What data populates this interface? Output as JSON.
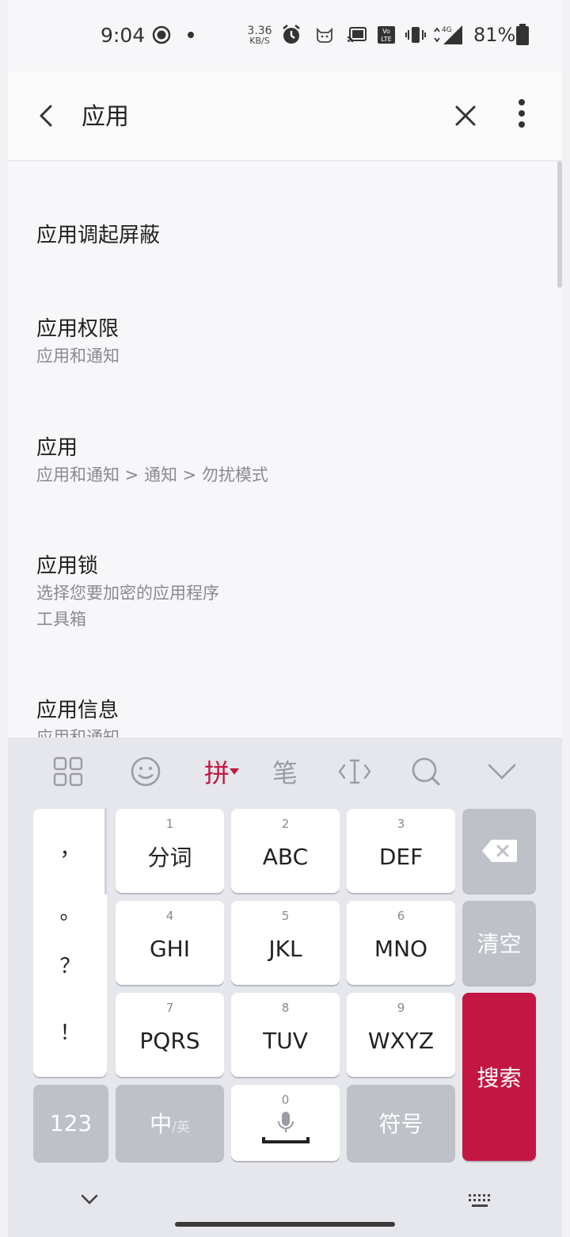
{
  "status_bar": {
    "time": "9:04",
    "net_speed_value": "3.36",
    "net_speed_unit": "KB/S",
    "battery": "81%",
    "icons": [
      "record-icon",
      "dot-icon",
      "alarm-icon",
      "cat-icon",
      "cast-icon",
      "volte-icon",
      "vibrate-icon",
      "4g-signal-icon",
      "battery-icon"
    ]
  },
  "topbar": {
    "title": "应用"
  },
  "results": [
    {
      "title": "应用调起屏蔽",
      "subtitles": []
    },
    {
      "title": "应用权限",
      "subtitles": [
        "应用和通知"
      ]
    },
    {
      "title": "应用",
      "subtitles": [
        "应用和通知 > 通知 > 勿扰模式"
      ]
    },
    {
      "title": "应用锁",
      "subtitles": [
        "选择您要加密的应用程序",
        "工具箱"
      ]
    },
    {
      "title": "应用信息",
      "subtitles": [
        "应用和通知"
      ]
    }
  ],
  "keyboard": {
    "mode_label": "拼",
    "stroke_label": "笔",
    "punct": [
      "，",
      "。",
      "？",
      "！"
    ],
    "keys": [
      {
        "num": "1",
        "label": "分词"
      },
      {
        "num": "2",
        "label": "ABC"
      },
      {
        "num": "3",
        "label": "DEF"
      },
      {
        "num": "4",
        "label": "GHI"
      },
      {
        "num": "5",
        "label": "JKL"
      },
      {
        "num": "6",
        "label": "MNO"
      },
      {
        "num": "7",
        "label": "PQRS"
      },
      {
        "num": "8",
        "label": "TUV"
      },
      {
        "num": "9",
        "label": "WXYZ"
      }
    ],
    "clear_label": "清空",
    "search_label": "搜索",
    "num_label": "123",
    "lang_main": "中",
    "lang_sub": "/英",
    "space_num": "0",
    "symbol_label": "符号",
    "colors": {
      "accent": "#c41642",
      "gray_key": "#bfc1c9"
    }
  }
}
